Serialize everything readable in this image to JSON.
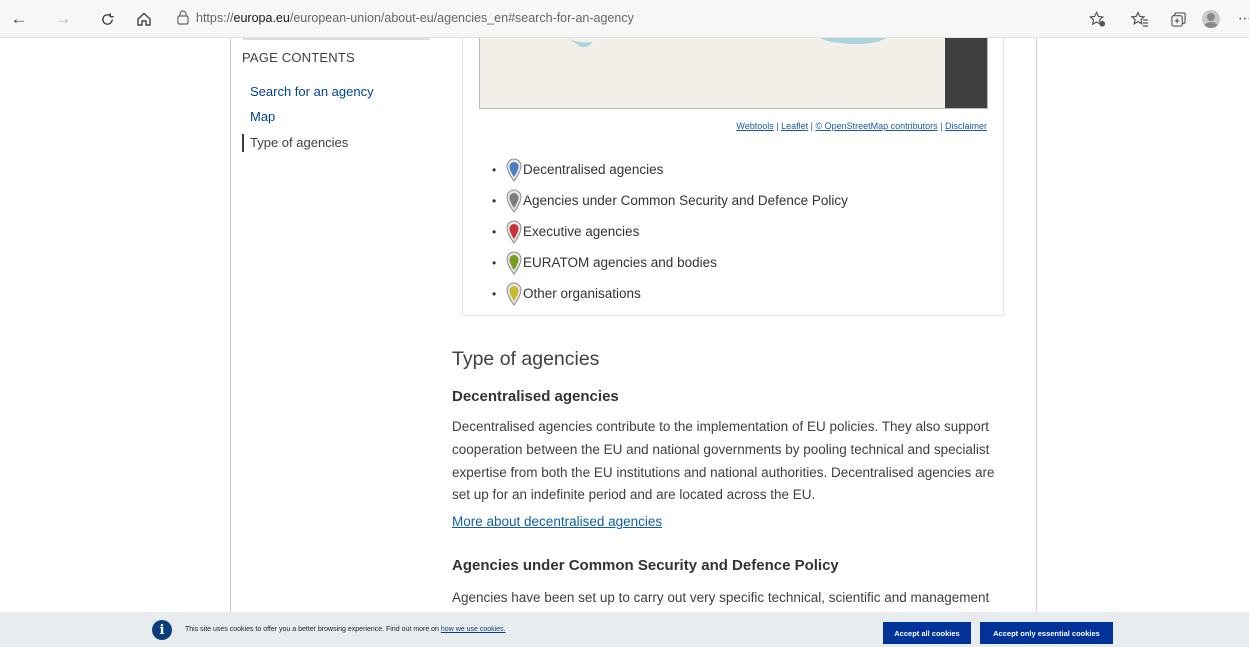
{
  "browser": {
    "url_prefix": "https://",
    "url_domain": "europa.eu",
    "url_rest": "/european-union/about-eu/agencies_en#search-for-an-agency"
  },
  "sidebar": {
    "title": "PAGE CONTENTS",
    "items": [
      {
        "label": "Search for an agency",
        "active": false
      },
      {
        "label": "Map",
        "active": false
      },
      {
        "label": "Type of agencies",
        "active": true
      }
    ]
  },
  "map": {
    "credits": {
      "webtools": "Webtools",
      "leaflet": "Leaflet",
      "osm": "© OpenStreetMap contributors",
      "disclaimer": "Disclaimer",
      "sep": " | "
    },
    "legend": [
      {
        "label": "Decentralised agencies",
        "color": "#4a7fc1",
        "icon": "map-pin-blue-icon"
      },
      {
        "label": "Agencies under Common Security and Defence Policy",
        "color": "#7d7d7d",
        "icon": "map-pin-grey-icon"
      },
      {
        "label": "Executive agencies",
        "color": "#c8333b",
        "icon": "map-pin-red-icon"
      },
      {
        "label": "EURATOM agencies and bodies",
        "color": "#7a9a1c",
        "icon": "map-pin-green-icon"
      },
      {
        "label": "Other organisations",
        "color": "#c7bb35",
        "icon": "map-pin-yellow-icon"
      }
    ]
  },
  "content": {
    "heading": "Type of agencies",
    "section1_title": "Decentralised agencies",
    "section1_text": "Decentralised agencies contribute to the implementation of EU policies. They also support cooperation between the EU and national governments by pooling technical and specialist expertise from both the EU institutions and national authorities. Decentralised agencies are set up for an indefinite period and are located across the EU.",
    "section1_link": "More about decentralised agencies",
    "section2_title": "Agencies under Common Security and Defence Policy",
    "section2_text": "Agencies have been set up to carry out very specific technical, scientific and management"
  },
  "cookie": {
    "text": "This site uses cookies to offer you a better browsing experience. Find out more on ",
    "link": "how we use cookies.",
    "accept_all": "Accept all cookies",
    "accept_essential": "Accept only essential cookies"
  },
  "colors": {
    "link": "#004494",
    "button": "#003399",
    "banner_bg": "#e9ecef"
  }
}
